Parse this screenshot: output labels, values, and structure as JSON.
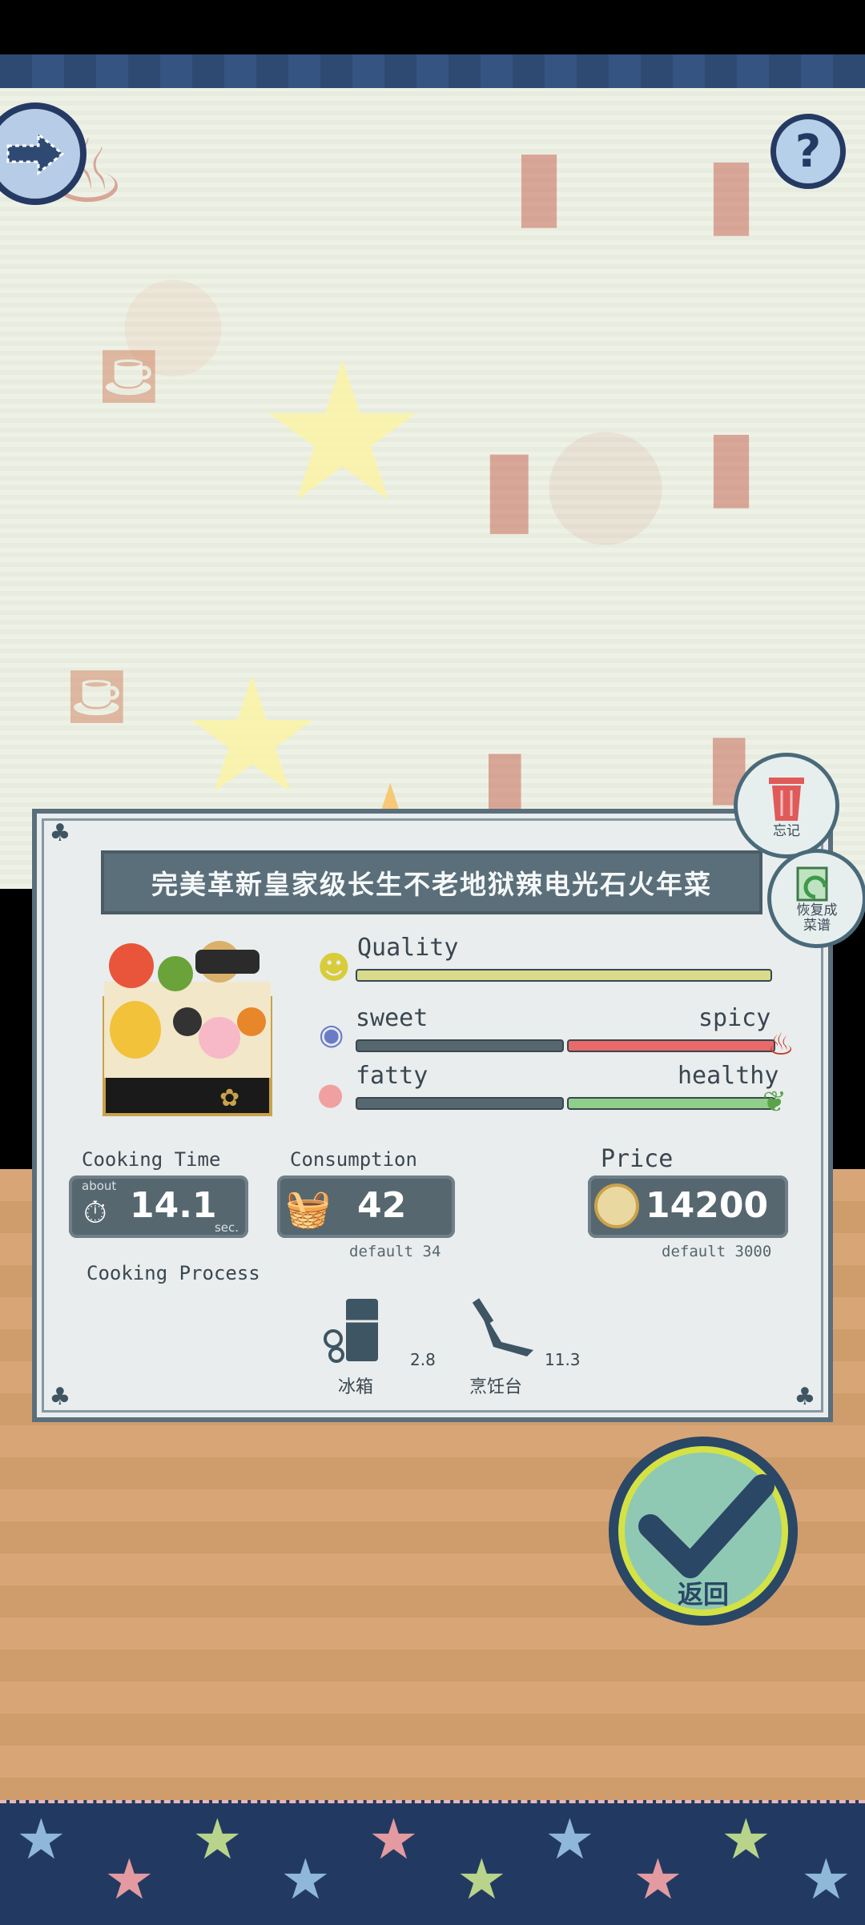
{
  "dish": {
    "name": "完美革新皇家级长生不老地狱辣电光石火年菜"
  },
  "stats": {
    "quality_label": "Quality",
    "quality_value": 1.0,
    "sweet_label": "sweet",
    "spicy_label": "spicy",
    "spicy_value": 0.5,
    "fatty_label": "fatty",
    "healthy_label": "healthy",
    "healthy_value": 0.5
  },
  "cooking_time": {
    "title": "Cooking Time",
    "about": "about",
    "value": "14.1",
    "unit": "sec."
  },
  "consumption": {
    "title": "Consumption",
    "value": "42",
    "default": "default 34"
  },
  "price": {
    "title": "Price",
    "value": "14200",
    "default": "default 3000"
  },
  "cooking_process": {
    "title": "Cooking Process",
    "steps": [
      {
        "label": "冰箱",
        "time": "2.8",
        "icon": "fridge-icon"
      },
      {
        "label": "烹饪台",
        "time": "11.3",
        "icon": "knife-icon"
      }
    ]
  },
  "buttons": {
    "forget": "忘记",
    "restore": "恢复成\n菜谱",
    "confirm": "返回"
  },
  "colors": {
    "navy": "#253a63",
    "panel": "#e9eded",
    "quality_bar": "#d8dc8a",
    "spicy_bar": "#e86a6a",
    "healthy_bar": "#8fcf8a"
  }
}
